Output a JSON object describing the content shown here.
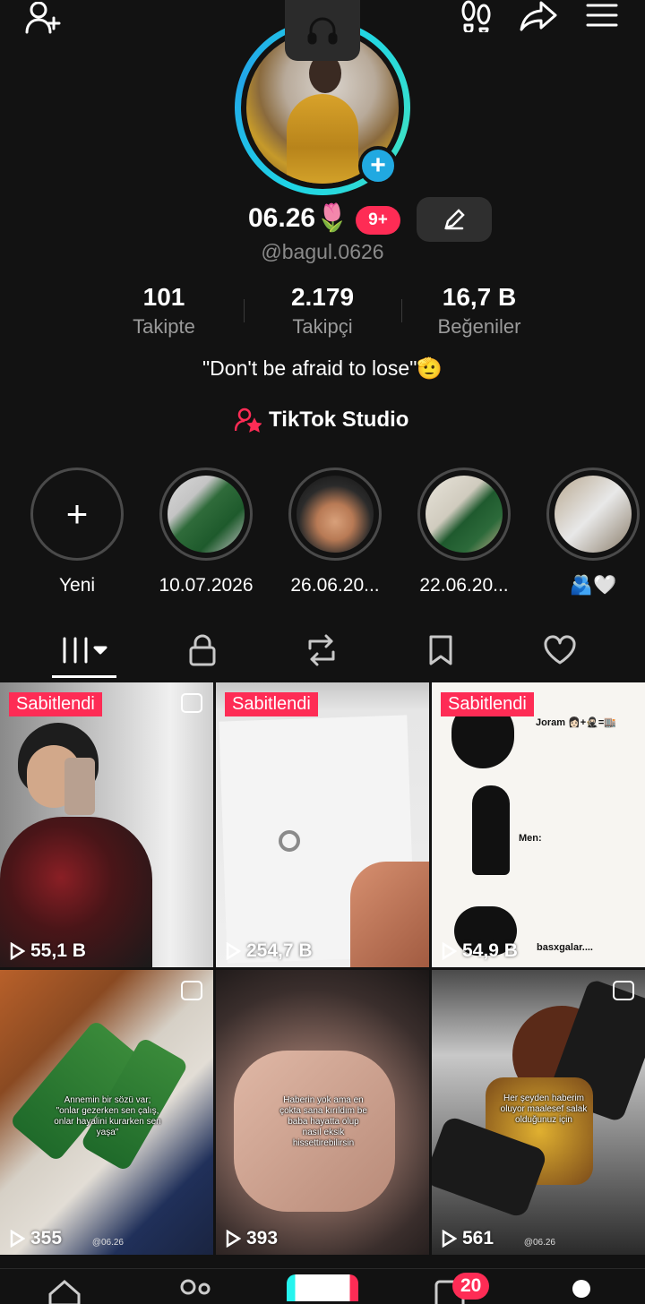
{
  "profile": {
    "display_name": "06.26🌷",
    "notifications": "9+",
    "username": "@bagul.0626",
    "bio": "\"Don't be afraid to lose\"🫡",
    "studio_label": "TikTok Studio"
  },
  "stats": [
    {
      "value": "101",
      "label": "Takipte"
    },
    {
      "value": "2.179",
      "label": "Takipçi"
    },
    {
      "value": "16,7 B",
      "label": "Beğeniler"
    }
  ],
  "highlights": [
    {
      "label": "Yeni",
      "kind": "new"
    },
    {
      "label": "10.07.2026"
    },
    {
      "label": "26.06.20..."
    },
    {
      "label": "22.06.20..."
    },
    {
      "label": "🫂🤍"
    }
  ],
  "tabs": [
    "videos-grid",
    "private",
    "reposts",
    "favorites",
    "liked"
  ],
  "posts": [
    {
      "pinned": "Sabitlendi",
      "views": "55,1 B",
      "multi": true
    },
    {
      "pinned": "Sabitlendi",
      "views": "254,7 B",
      "multi": false
    },
    {
      "pinned": "Sabitlendi",
      "views": "54,9 B",
      "multi": false,
      "text": {
        "top": "Joram 👩🏻+🥷🏻=🏬",
        "middle": "Men:",
        "bottom": "basxgalar...."
      }
    },
    {
      "views": "355",
      "multi": true,
      "caption": "Annemin bir sözü var; \"onlar gezerken sen çalış, onlar hayalini kurarken sen yaşa\"",
      "watermark": "@06.26"
    },
    {
      "views": "393",
      "multi": false,
      "caption": "Haberin yok ama en çokta sana kırıldım be baba hayatta olup nasıl eksik hissettirebilirsin"
    },
    {
      "views": "561",
      "multi": true,
      "caption": "Her şeyden haberim oluyor maalesef salak olduğunuz için",
      "watermark": "@06.26"
    }
  ],
  "inbox_badge": "20",
  "colors": {
    "accent": "#fe2c55",
    "ring": "#1fd5e6",
    "plus": "#21a9e1",
    "background": "#121212"
  }
}
